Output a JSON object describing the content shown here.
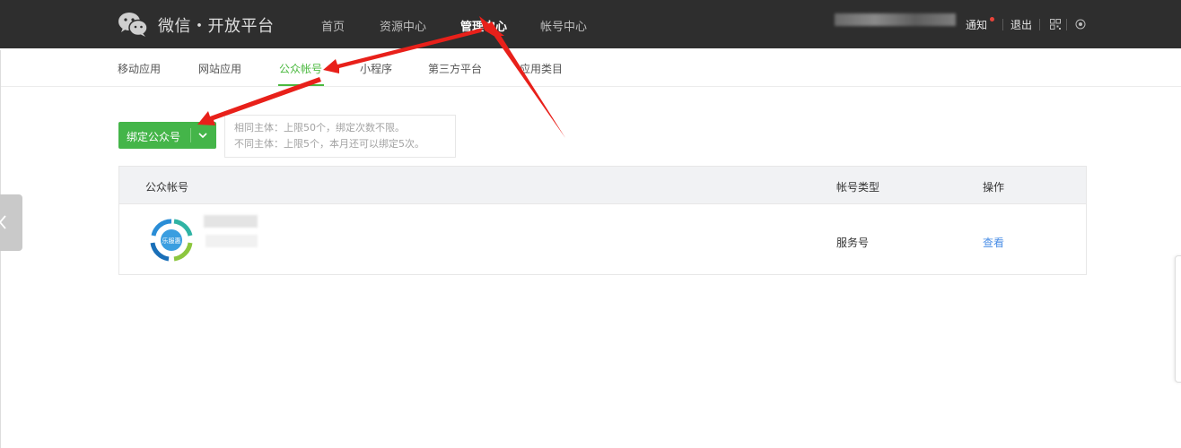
{
  "topbar": {
    "brand": "微信・开放平台",
    "nav": [
      "首页",
      "资源中心",
      "管理中心",
      "帐号中心"
    ],
    "active_nav": "管理中心",
    "notify": "通知",
    "logout": "退出",
    "icons": [
      "wechat-logo-icon",
      "qrcode-icon",
      "globe-icon"
    ]
  },
  "subnav": {
    "items": [
      "移动应用",
      "网站应用",
      "公众帐号",
      "小程序",
      "第三方平台",
      "应用类目"
    ],
    "active": "公众帐号"
  },
  "bind_button": {
    "label": "绑定公众号"
  },
  "tips": {
    "line1": "相同主体：上限50个，绑定次数不限。",
    "line2": "不同主体：上限5个，本月还可以绑定5次。"
  },
  "table": {
    "headers": [
      "公众帐号",
      "帐号类型",
      "操作"
    ],
    "rows": [
      {
        "logo_text": "乐服惠",
        "type": "服务号",
        "action": "查看"
      }
    ]
  },
  "colors": {
    "topbar_bg": "#2e2e2e",
    "accent_green": "#44b549",
    "link_blue": "#4a8ee6",
    "annotation_red": "#e8201a"
  }
}
